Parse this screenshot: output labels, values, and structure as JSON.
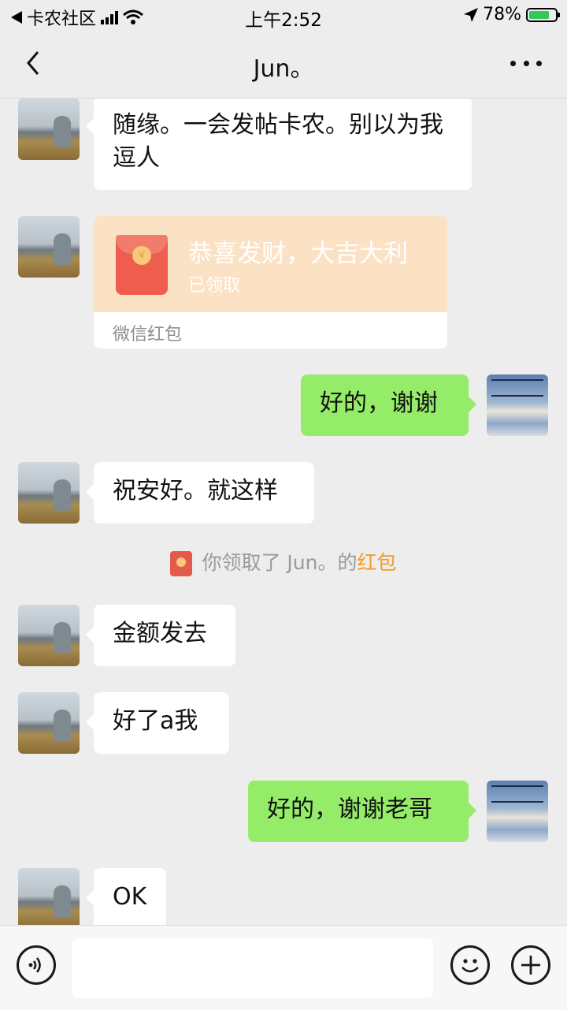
{
  "status_bar": {
    "back_app": "卡农社区",
    "time": "上午2:52",
    "battery": "78%",
    "battery_level": 0.78
  },
  "nav": {
    "title": "Jun。"
  },
  "messages": [
    {
      "from": "friend",
      "text": "随缘。一会发帖卡农。别以为我逗人"
    },
    {
      "from": "friend",
      "type": "red_packet",
      "title": "恭喜发财，大吉大利",
      "status": "已领取",
      "footer": "微信红包"
    },
    {
      "from": "me",
      "text": "好的，谢谢"
    },
    {
      "from": "friend",
      "text": "祝安好。就这样"
    },
    {
      "from": "friend",
      "text": "金额发去"
    },
    {
      "from": "friend",
      "text": "好了a我"
    },
    {
      "from": "me",
      "text": "好的，谢谢老哥"
    },
    {
      "from": "friend",
      "text": "OK"
    }
  ],
  "system_message": {
    "prefix": "你领取了 Jun。的",
    "link": "红包"
  },
  "input_bar": {
    "placeholder": ""
  },
  "colors": {
    "my_bubble": "#95ec69",
    "friend_bubble": "#ffffff",
    "link": "#f59a23",
    "background": "#ededed"
  }
}
